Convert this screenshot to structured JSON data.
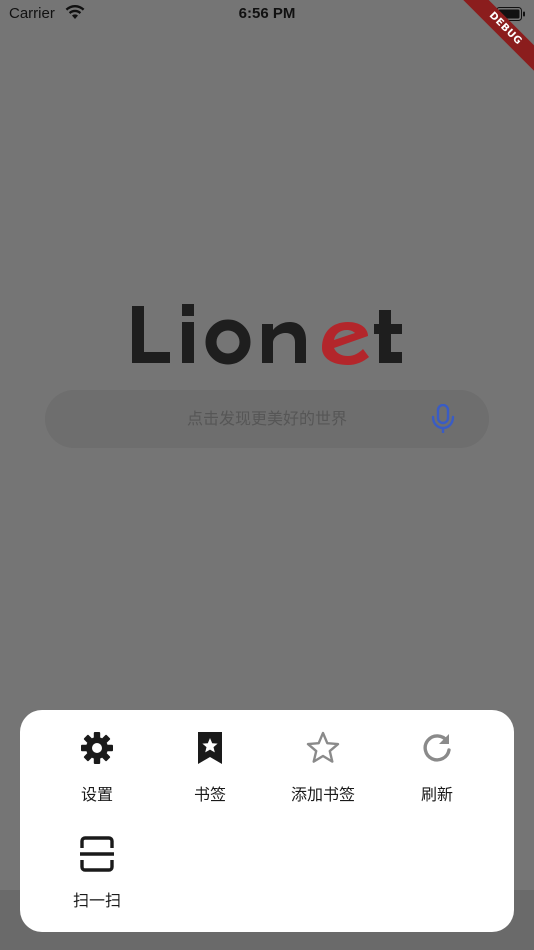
{
  "status_bar": {
    "carrier": "Carrier",
    "time": "6:56 PM"
  },
  "debug_ribbon": "DEBUG",
  "logo": {
    "text_dark": "Lion",
    "text_accent": "e",
    "text_dark_end": "t",
    "accent_color": "#b3262b"
  },
  "search": {
    "placeholder": "点击发现更美好的世界",
    "mic_icon": "mic-icon",
    "mic_color": "#3a5cc4"
  },
  "menu": {
    "items": [
      {
        "label": "设置",
        "icon": "gear-icon"
      },
      {
        "label": "书签",
        "icon": "bookmark-star-icon"
      },
      {
        "label": "添加书签",
        "icon": "star-outline-icon"
      },
      {
        "label": "刷新",
        "icon": "refresh-icon"
      },
      {
        "label": "扫一扫",
        "icon": "scan-icon"
      }
    ]
  }
}
